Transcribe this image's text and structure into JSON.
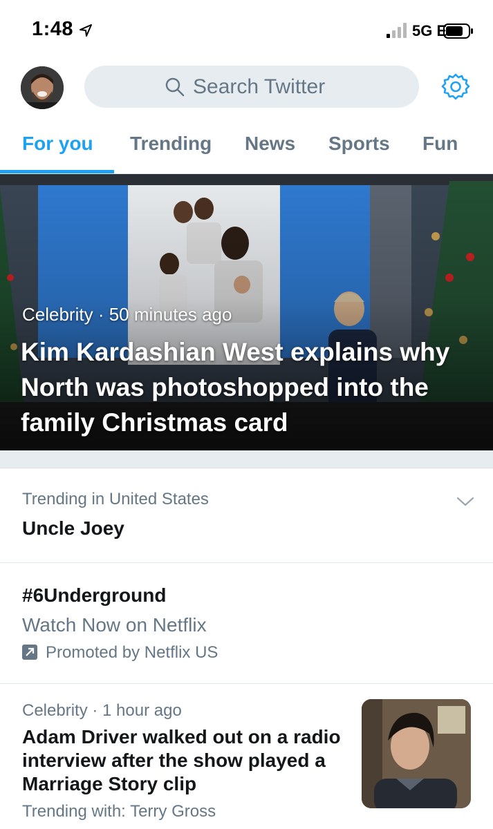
{
  "status_bar": {
    "time": "1:48",
    "network": "5G E"
  },
  "header": {
    "search_placeholder": "Search Twitter"
  },
  "tabs": [
    {
      "label": "For you",
      "active": true
    },
    {
      "label": "Trending",
      "active": false
    },
    {
      "label": "News",
      "active": false
    },
    {
      "label": "Sports",
      "active": false
    },
    {
      "label": "Fun",
      "active": false
    }
  ],
  "hero": {
    "category": "Celebrity",
    "time": "50 minutes ago",
    "meta": "Celebrity · 50 minutes ago",
    "title": "Kim Kardashian West explains why North was photoshopped into the family Christmas card"
  },
  "trending": {
    "context": "Trending in United States",
    "topic": "Uncle Joey"
  },
  "promoted": {
    "hashtag": "#6Underground",
    "description": "Watch Now on Netflix",
    "promoted_by": "Promoted by Netflix US"
  },
  "story": {
    "meta": "Celebrity · 1 hour ago",
    "title": "Adam Driver walked out on a radio interview after the show played a Marriage Story clip",
    "trending_with": "Trending with: Terry Gross"
  },
  "colors": {
    "accent": "#1da1f2",
    "muted_text": "#657786",
    "search_bg": "#e6ecf0"
  },
  "icons": [
    "location-arrow-icon",
    "signal-bars-icon",
    "battery-icon",
    "search-icon",
    "gear-icon",
    "chevron-down-icon",
    "promoted-arrow-icon"
  ]
}
